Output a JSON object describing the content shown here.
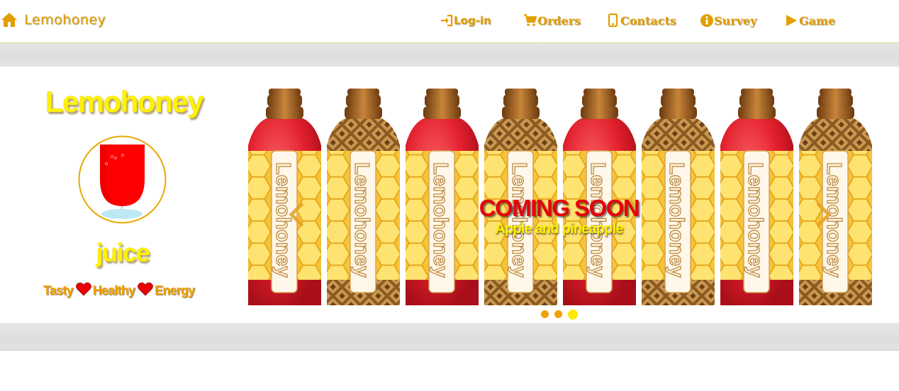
{
  "navbar": {
    "brand": {
      "label": "Lemohoney",
      "icon": "home-icon"
    },
    "items": [
      {
        "label": "Log-in",
        "icon": "login-icon"
      },
      {
        "label": "Orders",
        "icon": "cart-icon"
      },
      {
        "label": "Contacts",
        "icon": "phone-icon"
      },
      {
        "label": "Survey",
        "icon": "info-icon"
      },
      {
        "label": "Game",
        "icon": "play-icon"
      }
    ]
  },
  "hero": {
    "brand": "Lemohoney",
    "product": "juice",
    "cup_icon": "juice-glass-icon",
    "tagline": [
      "Tasty",
      "Healthy",
      "Energy"
    ],
    "tagline_icon": "heart-icon"
  },
  "carousel": {
    "bottle_label": "Lemohoney",
    "bottles": [
      "apple",
      "pineapple",
      "apple",
      "pineapple",
      "apple",
      "pineapple",
      "apple",
      "pineapple"
    ],
    "caption_title": "COMING SOON",
    "caption_subtitle": "Apple and pineapple",
    "prev_icon": "chevron-left-icon",
    "next_icon": "chevron-right-icon",
    "slide_count": 3,
    "active_slide": 3
  },
  "colors": {
    "accent": "#e39e00",
    "yellow": "#fff200",
    "red": "#e8000a",
    "divider": "#e3e07a"
  }
}
